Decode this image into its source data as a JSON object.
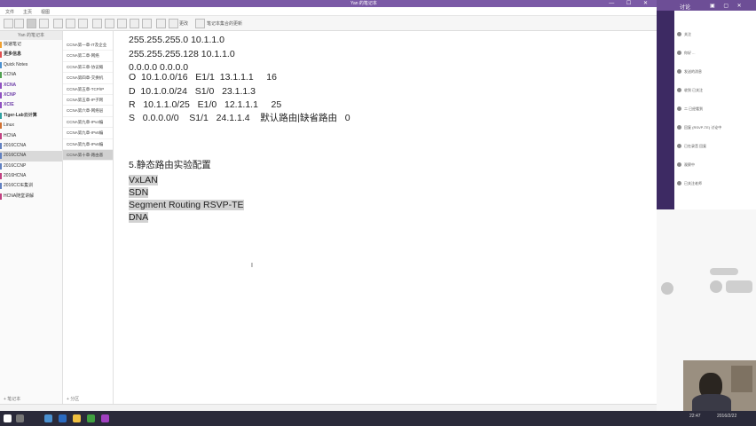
{
  "window": {
    "title": "Yan 的笔记本"
  },
  "menu": [
    "文件",
    "主页",
    "视图"
  ],
  "toolbar": {
    "item1": "更改",
    "item2": "笔记本集合的更新"
  },
  "sidebar": {
    "header": "Yan 的笔记本",
    "items": [
      {
        "label": "快速笔记",
        "style": "",
        "bar": "#f0a030"
      },
      {
        "label": "更多信息",
        "style": "bold",
        "bar": "#e05050"
      },
      {
        "label": "Quick Notes",
        "style": "",
        "bar": "#4a90d0"
      },
      {
        "label": "CCNA",
        "style": "",
        "bar": "#50a050"
      },
      {
        "label": "XCNA",
        "style": "purple",
        "bar": "#9050c0"
      },
      {
        "label": "XCNP",
        "style": "purple",
        "bar": "#9050c0"
      },
      {
        "label": "XCIE",
        "style": "purple",
        "bar": "#9050c0"
      },
      {
        "label": "Tiger-Lab云计算",
        "style": "bold",
        "bar": "#30a0a0"
      },
      {
        "label": "Linux",
        "style": "",
        "bar": "#d07030"
      },
      {
        "label": "HCNA",
        "style": "",
        "bar": "#c04080"
      },
      {
        "label": "2016CCNA",
        "style": "",
        "bar": "#6080c0"
      },
      {
        "label": "2016CCNA",
        "style": "sel",
        "bar": "#6080c0"
      },
      {
        "label": "2016CCNP",
        "style": "",
        "bar": "#6080c0"
      },
      {
        "label": "2016HCNA",
        "style": "",
        "bar": "#c04080"
      },
      {
        "label": "2016CCIE集训",
        "style": "",
        "bar": "#6080c0"
      },
      {
        "label": "HCNA随堂讲解",
        "style": "",
        "bar": "#c04080"
      }
    ],
    "footer": "+ 笔记本"
  },
  "sections": {
    "items": [
      {
        "label": "CCNA第一章-IT及企业",
        "sel": false
      },
      {
        "label": "CCNA第二章-网络",
        "sel": false
      },
      {
        "label": "CCNA第三章-协议概",
        "sel": false
      },
      {
        "label": "CCNA第四章-交换机",
        "sel": false
      },
      {
        "label": "CCNA第五章-TCP/IP",
        "sel": false
      },
      {
        "label": "CCNA第五章-IP子网",
        "sel": false
      },
      {
        "label": "CCNA第六章-网络层",
        "sel": false
      },
      {
        "label": "CCNA第九章-IPv4编",
        "sel": false
      },
      {
        "label": "CCNA第九章-IPv6编",
        "sel": false
      },
      {
        "label": "CCNA第九章-IPv6编",
        "sel": false
      },
      {
        "label": "CCNA第十章-路由基",
        "sel": true
      }
    ],
    "footer": "+ 分区"
  },
  "editor": {
    "lines": [
      "255.255.255.0 10.1.1.0",
      "255.255.255.128 10.1.1.0",
      "0.0.0.0 0.0.0.0",
      "O  10.1.0.0/16   E1/1  13.1.1.1     16",
      "D  10.1.0.0/24   S1/0   23.1.1.3",
      "R   10.1.1.0/25   E1/0   12.1.1.1     25",
      "S   0.0.0.0/0    S1/1   24.1.1.4    默认路由|缺省路由   0"
    ],
    "heading": "5.静态路由实验配置",
    "highlighted": [
      "VxLAN",
      "SDN",
      "Segment Routing RSVP-TE",
      "DNA"
    ],
    "cursor": "I"
  },
  "chat": {
    "header": "讨论",
    "messages": [
      "关注",
      "你好 ...",
      "发送的消息",
      "收到 已关注",
      "二 已经看到",
      "回复 (RSVP-TE) 讨论中",
      "已在录音 回复",
      "观察中",
      "已关注老师"
    ],
    "colors": {
      "purple": "#6d4e96",
      "dark": "#3d2a63"
    }
  },
  "taskbar": {
    "time": "22:47",
    "date": "2016/2/22"
  }
}
